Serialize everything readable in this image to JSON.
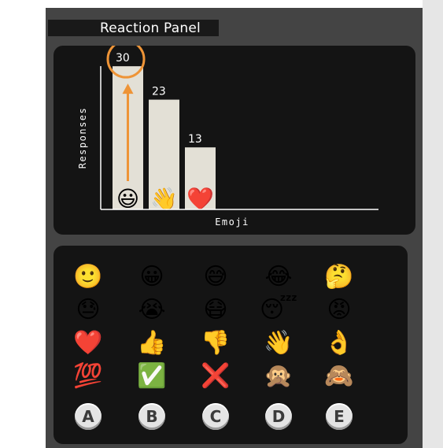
{
  "window": {
    "title": "Reaction Panel"
  },
  "chart_data": {
    "type": "bar",
    "categories": [
      "😃",
      "👋",
      "❤️"
    ],
    "values": [
      30,
      23,
      13
    ],
    "title": "",
    "xlabel": "Emoji",
    "ylabel": "Responses",
    "ylim": [
      0,
      32
    ],
    "grid": false,
    "legend": "none",
    "annotation": {
      "target_index": 0,
      "style": "orange circle and up arrow highlighting the top bar"
    },
    "colors": {
      "bar": "#e3e0d6",
      "axis": "#ffffff",
      "highlight": "#ee9437",
      "background": "#141414"
    }
  },
  "emoji_grid": {
    "rows": [
      [
        "🙂",
        "😀",
        "😅",
        "😂",
        "🤔"
      ],
      [
        "😓",
        "😭",
        "😷",
        "😴",
        "😡"
      ],
      [
        "❤️",
        "👍",
        "👎",
        "👋",
        "👌"
      ],
      [
        "💯",
        "✅",
        "❌",
        "🙊",
        "🙈"
      ]
    ],
    "choices": [
      "A",
      "B",
      "C",
      "D",
      "E"
    ]
  }
}
